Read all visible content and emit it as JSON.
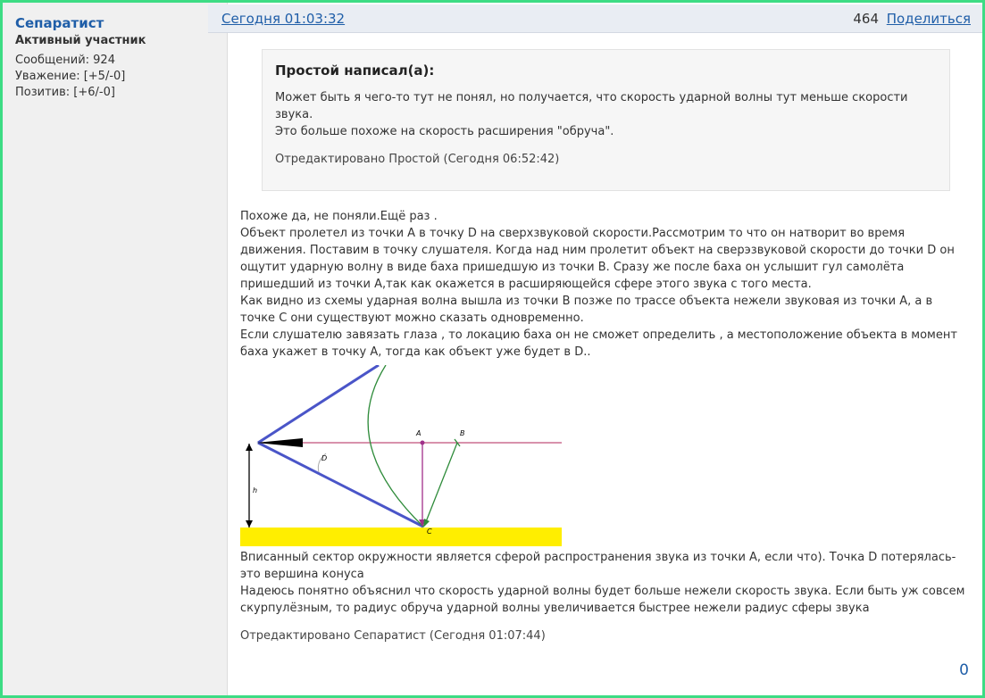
{
  "user": {
    "name": "Сепаратист",
    "rank": "Активный участник",
    "stats": [
      "Сообщений: 924",
      "Уважение: [+5/-0]",
      "Позитив: [+6/-0]"
    ]
  },
  "post": {
    "date": "Сегодня 01:03:32",
    "number": "464",
    "share_label": "Поделиться",
    "quote": {
      "author": "Простой написал(а):",
      "lines": [
        "Может быть я чего-то тут не понял, но получается, что скорость ударной волны тут меньше скорости звука.",
        "Это больше похоже на скорость расширения \"обруча\"."
      ],
      "edit": "Отредактировано Простой (Сегодня 06:52:42)"
    },
    "paragraphs": [
      "Похоже да, не поняли.Ещё раз  .",
      "Объект пролетел из точки А в точку D на сверхзвуковой скорости.Рассмотрим то что он натворит во время движения. Поставим в точку слушателя. Когда над ним пролетит объект на сверэзвуковой скорости до точки D он ощутит ударную волну в виде баха пришедшую из точки В. Сразу же после баха он услышит гул самолёта пришедший из точки А,так как окажется в расширяющейся сфере этого звука с того места.",
      "Как видно из схемы ударная волна вышла из точки В позже по трассе объекта нежели звуковая из точки А, а в точке С они существуют можно сказать  одновременно.",
      "Если слушателю завязать глаза , то локацию баха он не сможет определить , а местоположение объекта в момент баха укажет в точку А, тогда как объект уже будет в D.."
    ],
    "figure_labels": {
      "a": "A",
      "b": "B",
      "c": "C",
      "d": "D",
      "h": "h"
    },
    "paragraphs_after": [
      "Вписанный сектор окружности является сферой распространения звука из точки А, если что). Точка D потерялась- это вершина конуса",
      "Надеюсь понятно объяснил что скорость ударной волны будет больше нежели скорость звука. Если быть уж совсем скурпулёзным, то радиус обруча ударной волны увеличивается быстрее нежели радиус сферы звука"
    ],
    "edit": "Отредактировано Сепаратист (Сегодня 01:07:44)",
    "rep_count": "0"
  },
  "colors": {
    "frame": "#3ddc84",
    "link": "#1f5ea8",
    "header_bg": "#e9edf3",
    "sidebar_bg": "#f0f0f0",
    "cone": "#4a55c8",
    "arc": "#2e8b3a",
    "path": "#c0507a",
    "ground": "#ffee00"
  }
}
